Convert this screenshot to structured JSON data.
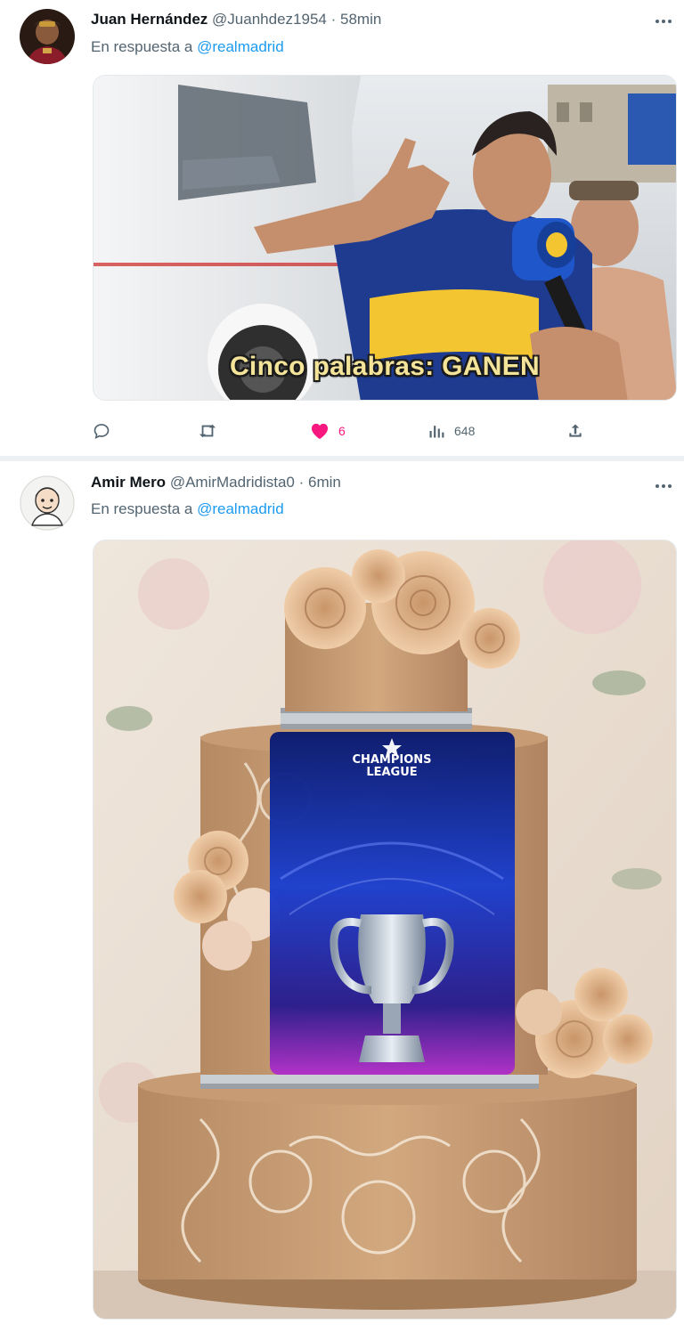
{
  "tweets": [
    {
      "author": {
        "name": "Juan Hernández",
        "handle": "@Juanhdez1954",
        "time": "58min"
      },
      "separator": "·",
      "reply_to": {
        "prefix": "En respuesta a",
        "handle": "@realmadrid"
      },
      "media": {
        "caption": "Cinco palabras: GANEN"
      },
      "actions": {
        "likes": "6",
        "views": "648"
      },
      "icons": [
        "more-icon",
        "reply-icon",
        "repost-icon",
        "heart-icon",
        "views-icon",
        "share-icon"
      ]
    },
    {
      "author": {
        "name": "Amir Mero",
        "handle": "@AmirMadridista0",
        "time": "6min"
      },
      "separator": "·",
      "reply_to": {
        "prefix": "En respuesta a",
        "handle": "@realmadrid"
      },
      "media": {
        "logo_text_1": "CHAMPIONS",
        "logo_text_2": "LEAGUE"
      },
      "icons": [
        "more-icon"
      ]
    }
  ],
  "colors": {
    "accent": "#1d9bf0",
    "like": "#f91880",
    "muted": "#536471"
  }
}
